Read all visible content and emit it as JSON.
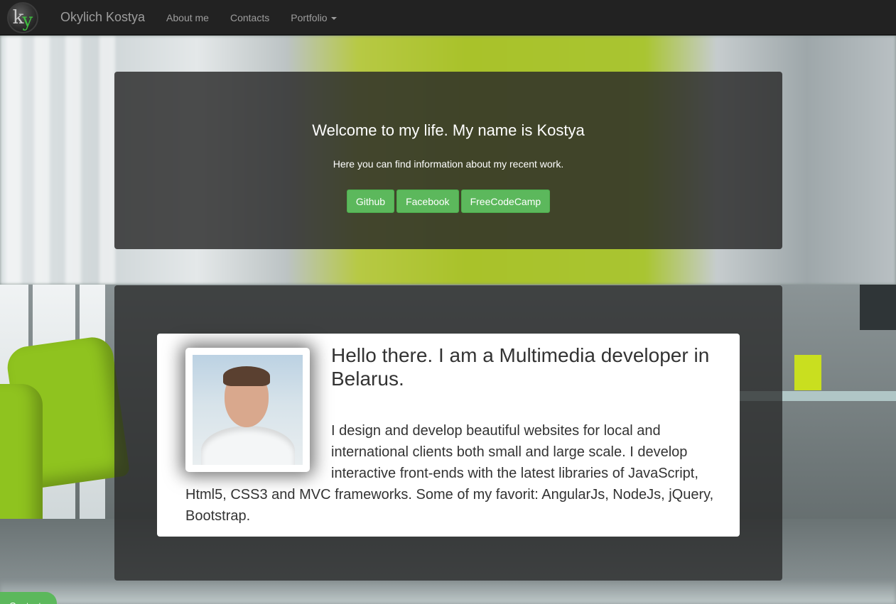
{
  "navbar": {
    "logo_letters": {
      "k": "k",
      "y": "y"
    },
    "brand": "Okylich Kostya",
    "links": [
      {
        "label": "About me"
      },
      {
        "label": "Contacts"
      },
      {
        "label": "Portfolio",
        "dropdown": true
      }
    ]
  },
  "hero": {
    "title": "Welcome to my life. My name is Kostya",
    "subtitle": "Here you can find information about my recent work.",
    "buttons": [
      {
        "label": "Github"
      },
      {
        "label": "Facebook"
      },
      {
        "label": "FreeCodeCamp"
      }
    ]
  },
  "about": {
    "heading": "Hello there. I am a Multimedia developer in Belarus.",
    "text": "I design and develop beautiful websites for local and international clients both small and large scale. I develop interactive front-ends with the latest libraries of JavaScript, Html5, CSS3 and MVC frameworks. Some of my favorit: AngularJs, NodeJs, jQuery, Bootstrap."
  },
  "footer_tab": {
    "label": "Contacts"
  },
  "colors": {
    "navbar_bg": "#222222",
    "button_green": "#5cb85c",
    "panel_dark": "rgba(40,40,40,0.82)",
    "logo_green": "#3fbf3f"
  }
}
